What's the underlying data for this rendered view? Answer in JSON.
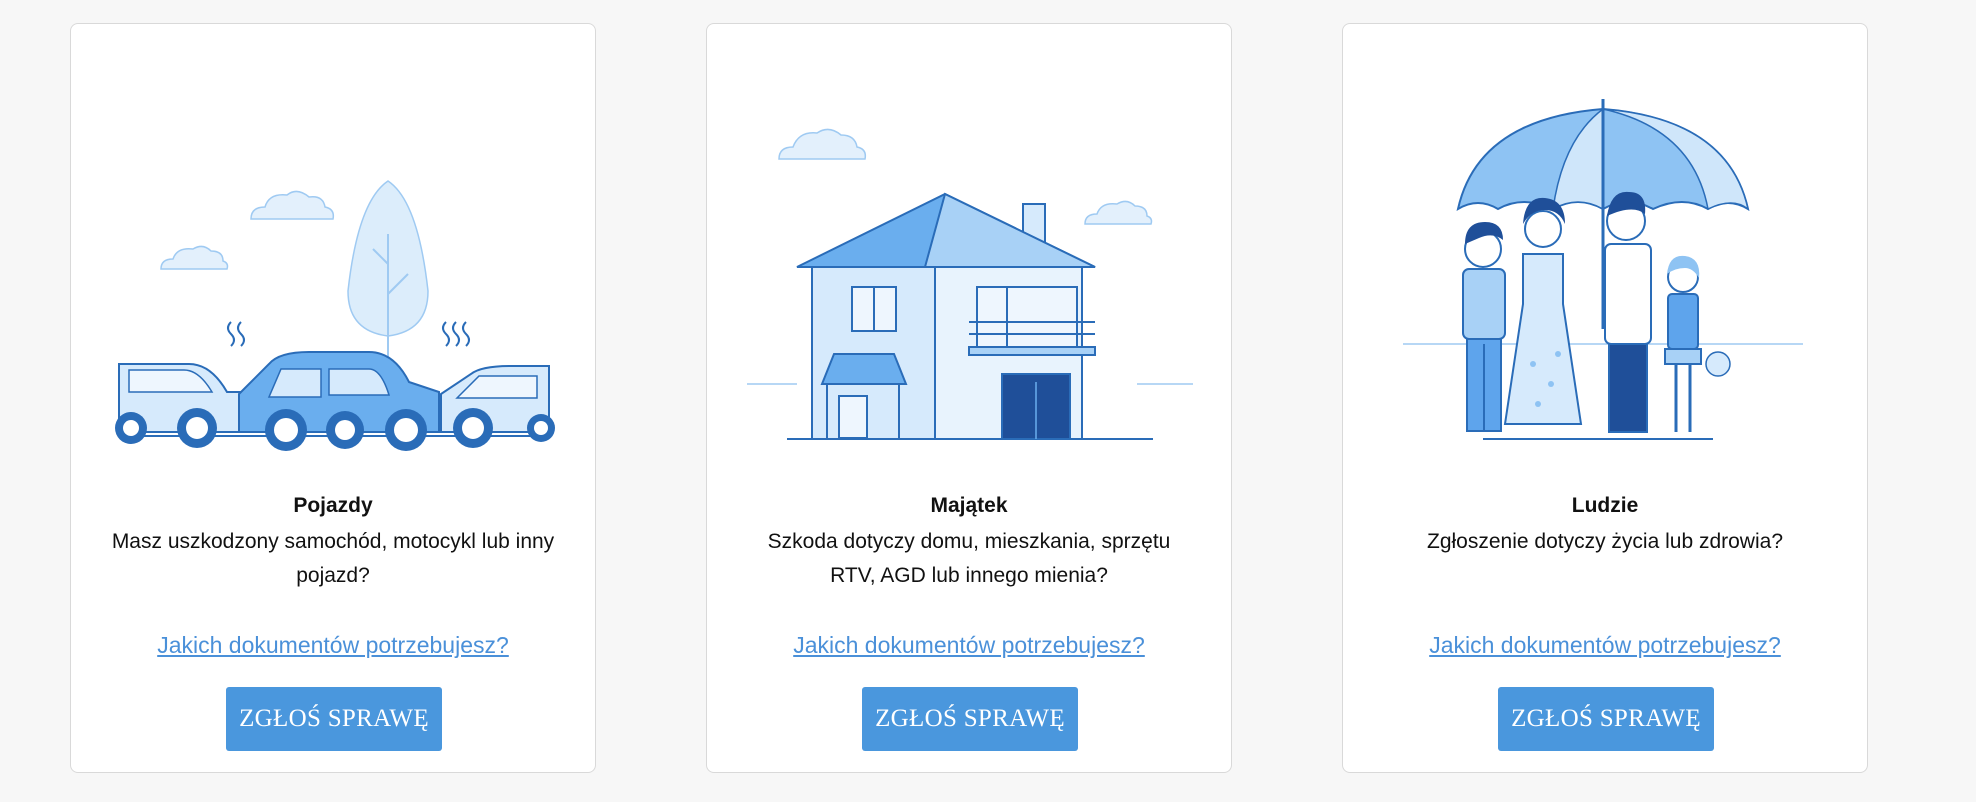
{
  "colors": {
    "accent": "#4a97dd",
    "link": "#4a90d9",
    "illustration_dark": "#2a6cb8",
    "illustration_mid": "#5ea4ec",
    "illustration_light": "#cfe6fa"
  },
  "cards": [
    {
      "title": "Pojazdy",
      "description": "Masz uszkodzony samochód, motocykl lub inny pojazd?",
      "link": "Jakich dokumentów potrzebujesz?",
      "button": "ZGŁOŚ SPRAWĘ",
      "illustration": "car-crash-illustration"
    },
    {
      "title": "Majątek",
      "description": "Szkoda dotyczy domu, mieszkania, sprzętu RTV, AGD lub innego mienia?",
      "link": "Jakich dokumentów potrzebujesz?",
      "button": "ZGŁOŚ SPRAWĘ",
      "illustration": "house-illustration"
    },
    {
      "title": "Ludzie",
      "description": "Zgłoszenie dotyczy życia lub zdrowia?",
      "link": "Jakich dokumentów potrzebujesz?",
      "button": "ZGŁOŚ SPRAWĘ",
      "illustration": "family-umbrella-illustration"
    }
  ]
}
